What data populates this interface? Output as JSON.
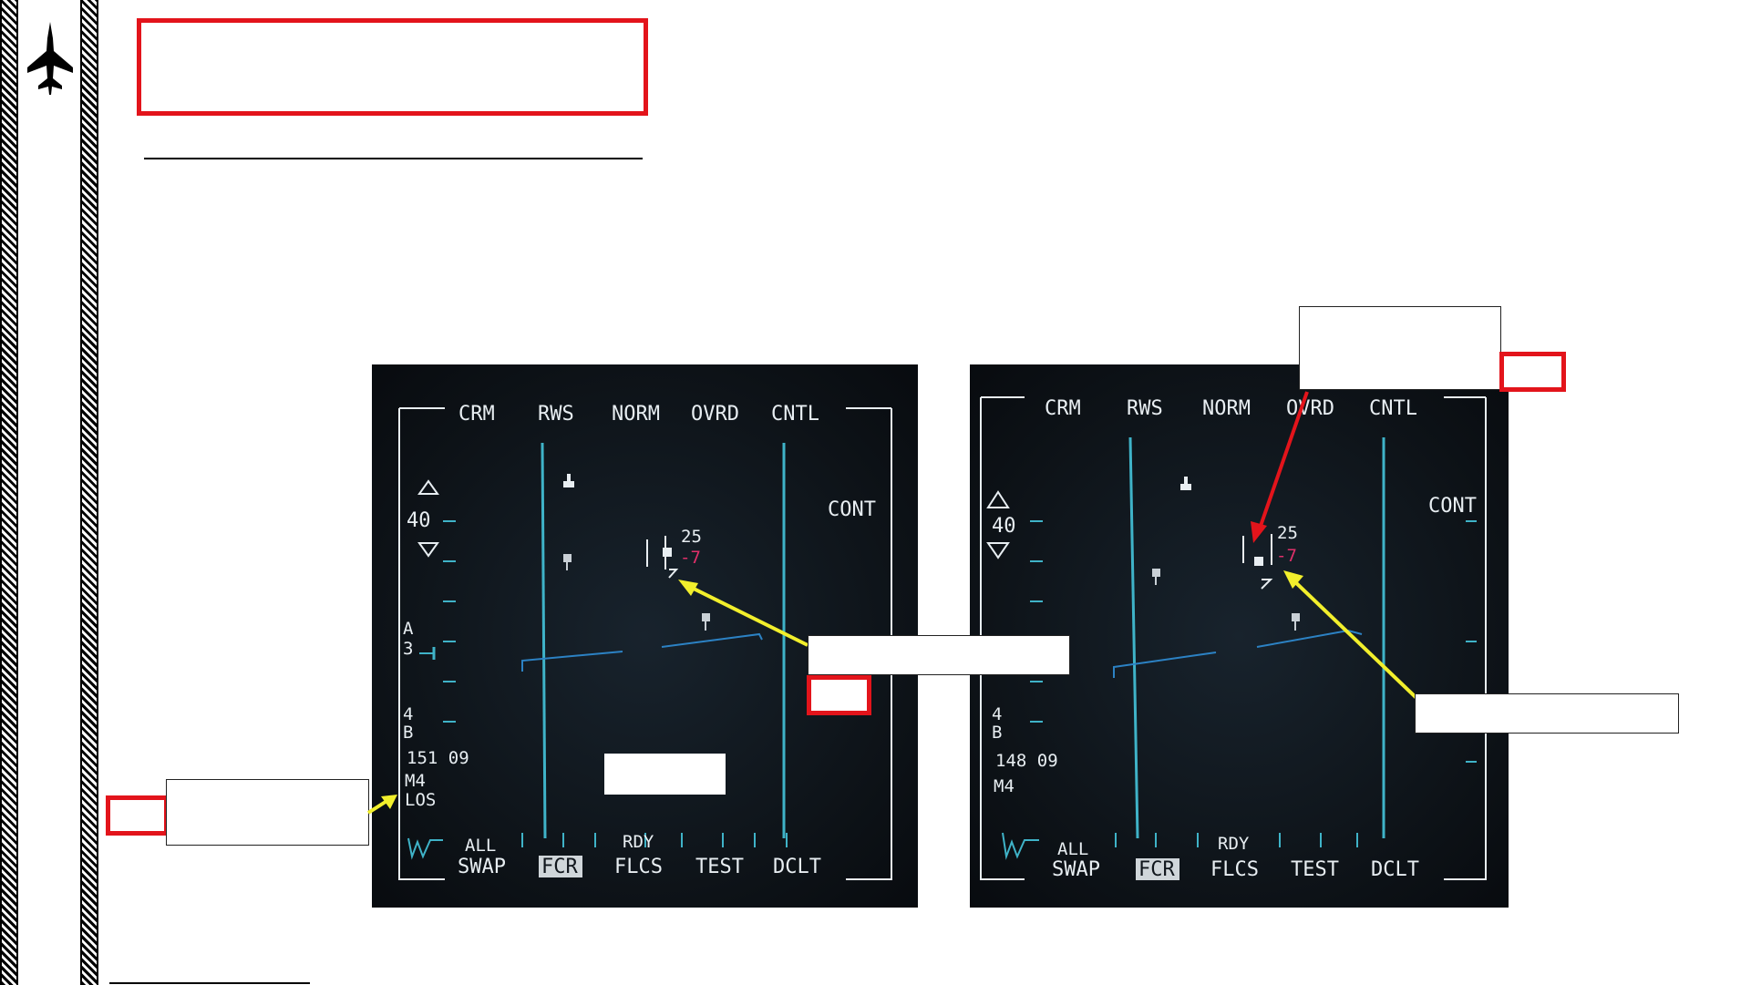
{
  "sidebar": {
    "icon": "jet-aircraft-icon"
  },
  "colors": {
    "red": "#e3141b",
    "yellow": "#f2ef2c",
    "cyan": "#3fb3c8",
    "magenta": "#e0306a",
    "mfd_bg": "#0d1217"
  },
  "left_mfd": {
    "top_labels": [
      "CRM",
      "RWS",
      "NORM",
      "OVRD",
      "CNTL"
    ],
    "cont_label": "CONT",
    "range": "40",
    "az_a": "A",
    "az_a_val": "3",
    "bar_b_val": "4",
    "bar_b": "B",
    "readout": "151 09",
    "mode_m": "M4",
    "los": "LOS",
    "target_alt": "25",
    "target_closure": "-7",
    "all_label": "ALL",
    "rdy_label": "RDY",
    "bottom_labels": [
      "SWAP",
      "FCR",
      "FLCS",
      "TEST",
      "DCLT"
    ]
  },
  "right_mfd": {
    "top_labels": [
      "CRM",
      "RWS",
      "NORM",
      "OVRD",
      "CNTL"
    ],
    "cont_label": "CONT",
    "range": "40",
    "bar_b_val": "4",
    "bar_b": "B",
    "readout": "148 09",
    "mode_m": "M4",
    "target_alt": "25",
    "target_closure": "-7",
    "all_label": "ALL",
    "rdy_label": "RDY",
    "bottom_labels": [
      "SWAP",
      "FCR",
      "FLCS",
      "TEST",
      "DCLT"
    ]
  }
}
